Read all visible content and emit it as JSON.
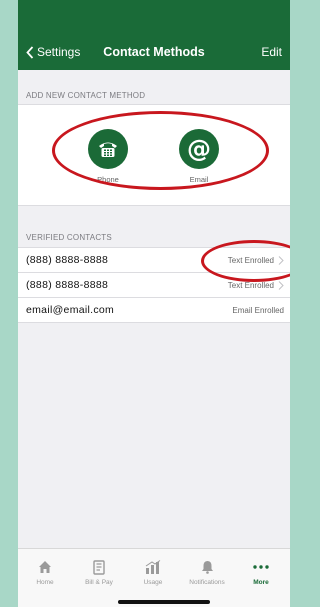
{
  "nav": {
    "back_label": "Settings",
    "title": "Contact Methods",
    "edit_label": "Edit"
  },
  "add_section": {
    "header": "ADD NEW CONTACT METHOD",
    "methods": [
      {
        "label": "Phone",
        "icon": "telephone-icon"
      },
      {
        "label": "Email",
        "icon": "at-sign-icon"
      }
    ]
  },
  "verified_section": {
    "header": "VERIFIED CONTACTS",
    "contacts": [
      {
        "value": "(888) 8888-8888",
        "status": "Text Enrolled"
      },
      {
        "value": "(888) 8888-8888",
        "status": "Text Enrolled"
      },
      {
        "value": "email@email.com",
        "status": "Email Enrolled"
      }
    ]
  },
  "tabbar": {
    "tabs": [
      {
        "label": "Home",
        "icon": "house-icon"
      },
      {
        "label": "Bill & Pay",
        "icon": "bill-icon"
      },
      {
        "label": "Usage",
        "icon": "usage-chart-icon"
      },
      {
        "label": "Notifications",
        "icon": "bell-icon"
      },
      {
        "label": "More",
        "icon": "more-dots-icon",
        "active": true
      }
    ]
  },
  "colors": {
    "brand_green": "#1a6b38",
    "highlight_red": "#c8171e",
    "background_teal": "#a8d7c7"
  }
}
